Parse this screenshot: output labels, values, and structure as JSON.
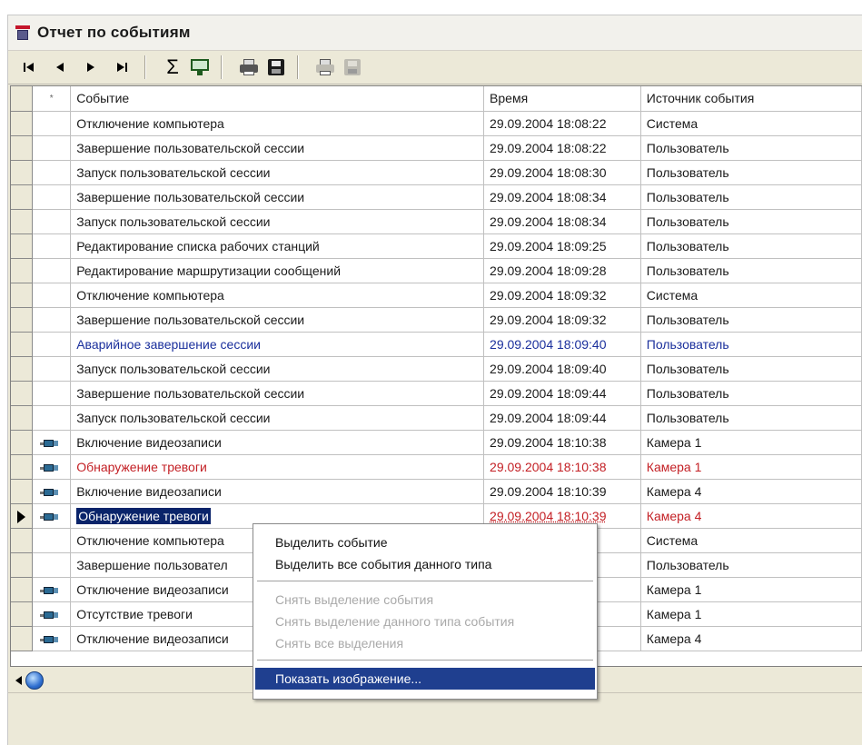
{
  "window": {
    "title": "Отчет по событиям"
  },
  "toolbar": {
    "nav": [
      "I◄",
      "◄",
      "►",
      "►I"
    ],
    "sum_symbol": "Σ"
  },
  "grid": {
    "columns": [
      "*",
      "Событие",
      "Время",
      "Источник события"
    ],
    "rows": [
      {
        "icon": "",
        "event": "Отключение компьютера",
        "time": "29.09.2004 18:08:22",
        "source": "Система"
      },
      {
        "icon": "",
        "event": "Завершение пользовательской сессии",
        "time": "29.09.2004 18:08:22",
        "source": "Пользователь"
      },
      {
        "icon": "",
        "event": "Запуск пользовательской сессии",
        "time": "29.09.2004 18:08:30",
        "source": "Пользователь"
      },
      {
        "icon": "",
        "event": "Завершение пользовательской сессии",
        "time": "29.09.2004 18:08:34",
        "source": "Пользователь"
      },
      {
        "icon": "",
        "event": "Запуск пользовательской сессии",
        "time": "29.09.2004 18:08:34",
        "source": "Пользователь"
      },
      {
        "icon": "",
        "event": "Редактирование списка рабочих станций",
        "time": "29.09.2004 18:09:25",
        "source": "Пользователь"
      },
      {
        "icon": "",
        "event": "Редактирование маршрутизации сообщений",
        "time": "29.09.2004 18:09:28",
        "source": "Пользователь"
      },
      {
        "icon": "",
        "event": "Отключение компьютера",
        "time": "29.09.2004 18:09:32",
        "source": "Система"
      },
      {
        "icon": "",
        "event": "Завершение пользовательской сессии",
        "time": "29.09.2004 18:09:32",
        "source": "Пользователь"
      },
      {
        "icon": "",
        "event": "Аварийное завершение сессии",
        "time": "29.09.2004 18:09:40",
        "source": "Пользователь",
        "style": "blue"
      },
      {
        "icon": "",
        "event": "Запуск пользовательской сессии",
        "time": "29.09.2004 18:09:40",
        "source": "Пользователь"
      },
      {
        "icon": "",
        "event": "Завершение пользовательской сессии",
        "time": "29.09.2004 18:09:44",
        "source": "Пользователь"
      },
      {
        "icon": "",
        "event": "Запуск пользовательской сессии",
        "time": "29.09.2004 18:09:44",
        "source": "Пользователь"
      },
      {
        "icon": "camera-icon",
        "event": "Включение видеозаписи",
        "time": "29.09.2004 18:10:38",
        "source": "Камера 1"
      },
      {
        "icon": "camera-icon",
        "event": "Обнаружение тревоги",
        "time": "29.09.2004 18:10:38",
        "source": "Камера 1",
        "style": "red"
      },
      {
        "icon": "camera-icon",
        "event": "Включение видеозаписи",
        "time": "29.09.2004 18:10:39",
        "source": "Камера 4"
      },
      {
        "icon": "camera-icon",
        "event": "Обнаружение тревоги",
        "time": "29.09.2004 18:10:39",
        "source": "Камера 4",
        "style": "red",
        "selected": true
      },
      {
        "icon": "",
        "event": "Отключение компьютера",
        "time": "0:40",
        "source": "Система"
      },
      {
        "icon": "",
        "event": "Завершение пользовател",
        "time": "0:40",
        "source": "Пользователь"
      },
      {
        "icon": "camera-icon",
        "event": "Отключение видеозаписи",
        "time": "0:41",
        "source": "Камера 1"
      },
      {
        "icon": "camera-icon",
        "event": "Отсутствие тревоги",
        "time": "0:41",
        "source": "Камера 1"
      },
      {
        "icon": "camera-icon",
        "event": "Отключение видеозаписи",
        "time": "0:41",
        "source": "Камера 4"
      }
    ]
  },
  "context_menu": {
    "items": [
      {
        "label": "Выделить событие",
        "enabled": true
      },
      {
        "label": "Выделить все события данного типа",
        "enabled": true
      },
      {
        "separator": true
      },
      {
        "label": "Снять выделение события",
        "enabled": false
      },
      {
        "label": "Снять выделение данного типа события",
        "enabled": false
      },
      {
        "label": "Снять все выделения",
        "enabled": false
      },
      {
        "separator": true
      },
      {
        "label": "Показать изображение...",
        "enabled": true,
        "highlighted": true
      }
    ]
  },
  "colors": {
    "selection": "#0a246a",
    "alarm": "#c31f24",
    "crash": "#1a2f9c",
    "menu_highlight": "#1f3f8f"
  }
}
